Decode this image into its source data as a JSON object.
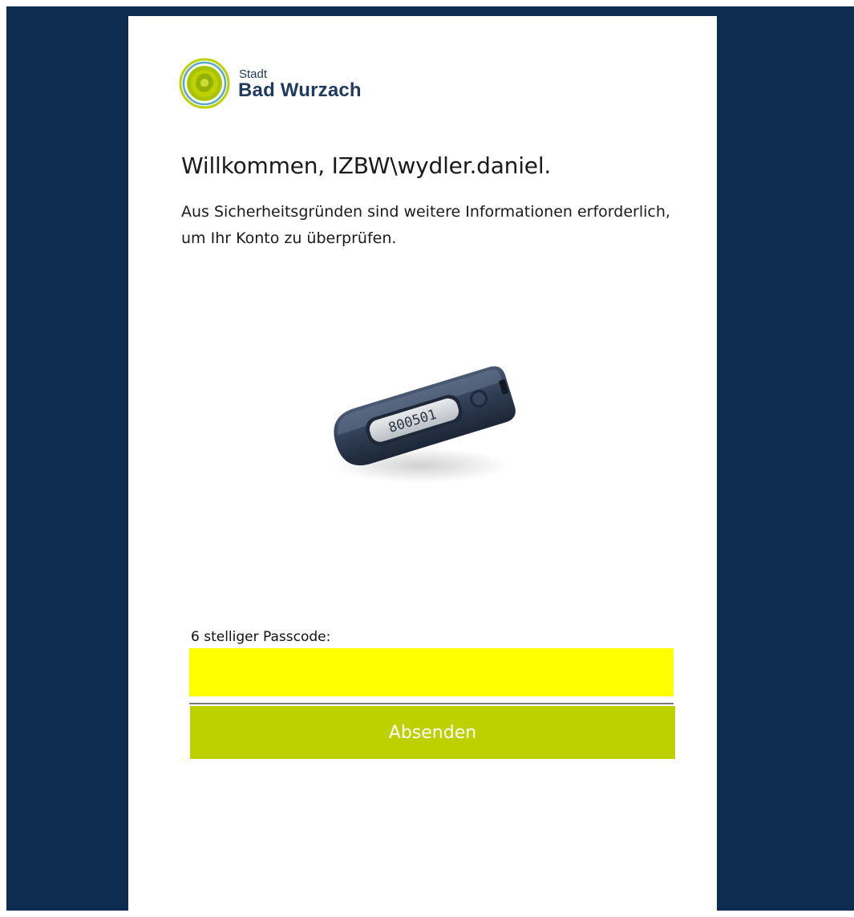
{
  "brand": {
    "city_prefix": "Stadt",
    "city_name": "Bad Wurzach"
  },
  "heading": {
    "welcome": "Willkommen, IZBW\\wydler.daniel."
  },
  "intro": {
    "text": "Aus Sicherheitsgründen sind weitere Informationen erforderlich, um Ihr Konto zu überprüfen."
  },
  "token_device": {
    "display_code": "800501"
  },
  "form": {
    "passcode_label": "6 stelliger Passcode:",
    "passcode_value": "",
    "submit_label": "Absenden"
  },
  "colors": {
    "background": "#0d2c4f",
    "input_highlight": "#ffff00",
    "accent": "#bdd000"
  }
}
